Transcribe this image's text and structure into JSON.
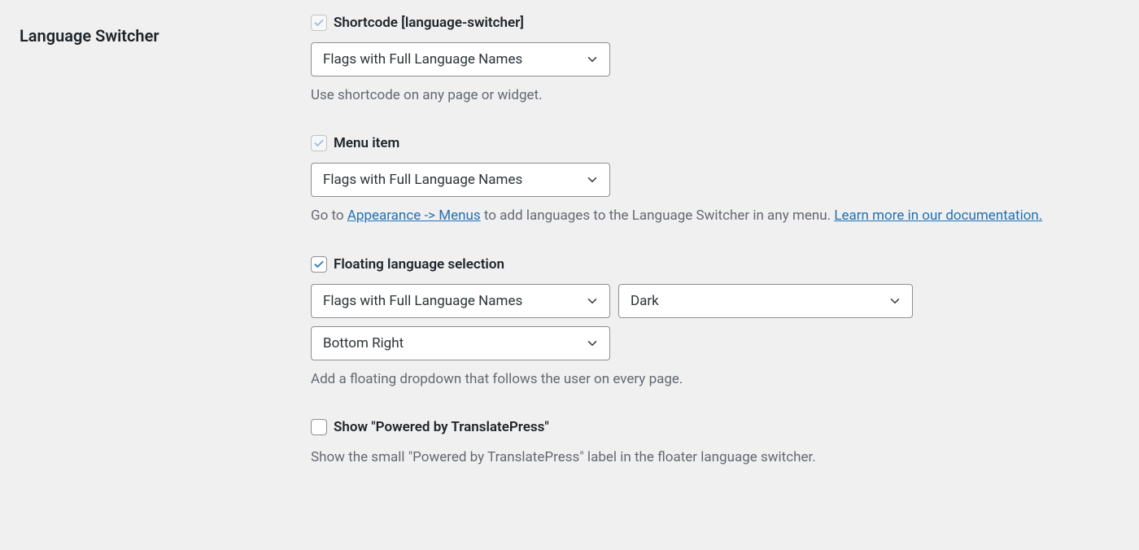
{
  "section": {
    "title": "Language Switcher"
  },
  "shortcode": {
    "label": "Shortcode [language-switcher]",
    "checked": true,
    "disabled": true,
    "select": "Flags with Full Language Names",
    "desc": "Use shortcode on any page or widget."
  },
  "menu": {
    "label": "Menu item",
    "checked": true,
    "disabled": true,
    "select": "Flags with Full Language Names",
    "desc_prefix": "Go to ",
    "link1": "Appearance -> Menus",
    "desc_mid": " to add languages to the Language Switcher in any menu. ",
    "link2": "Learn more in our documentation."
  },
  "floating": {
    "label": "Floating language selection",
    "checked": true,
    "disabled": false,
    "select_style": "Flags with Full Language Names",
    "select_theme": "Dark",
    "select_pos": "Bottom Right",
    "desc": "Add a floating dropdown that follows the user on every page."
  },
  "powered": {
    "label": "Show \"Powered by TranslatePress\"",
    "checked": false,
    "disabled": false,
    "desc": "Show the small \"Powered by TranslatePress\" label in the floater language switcher."
  }
}
